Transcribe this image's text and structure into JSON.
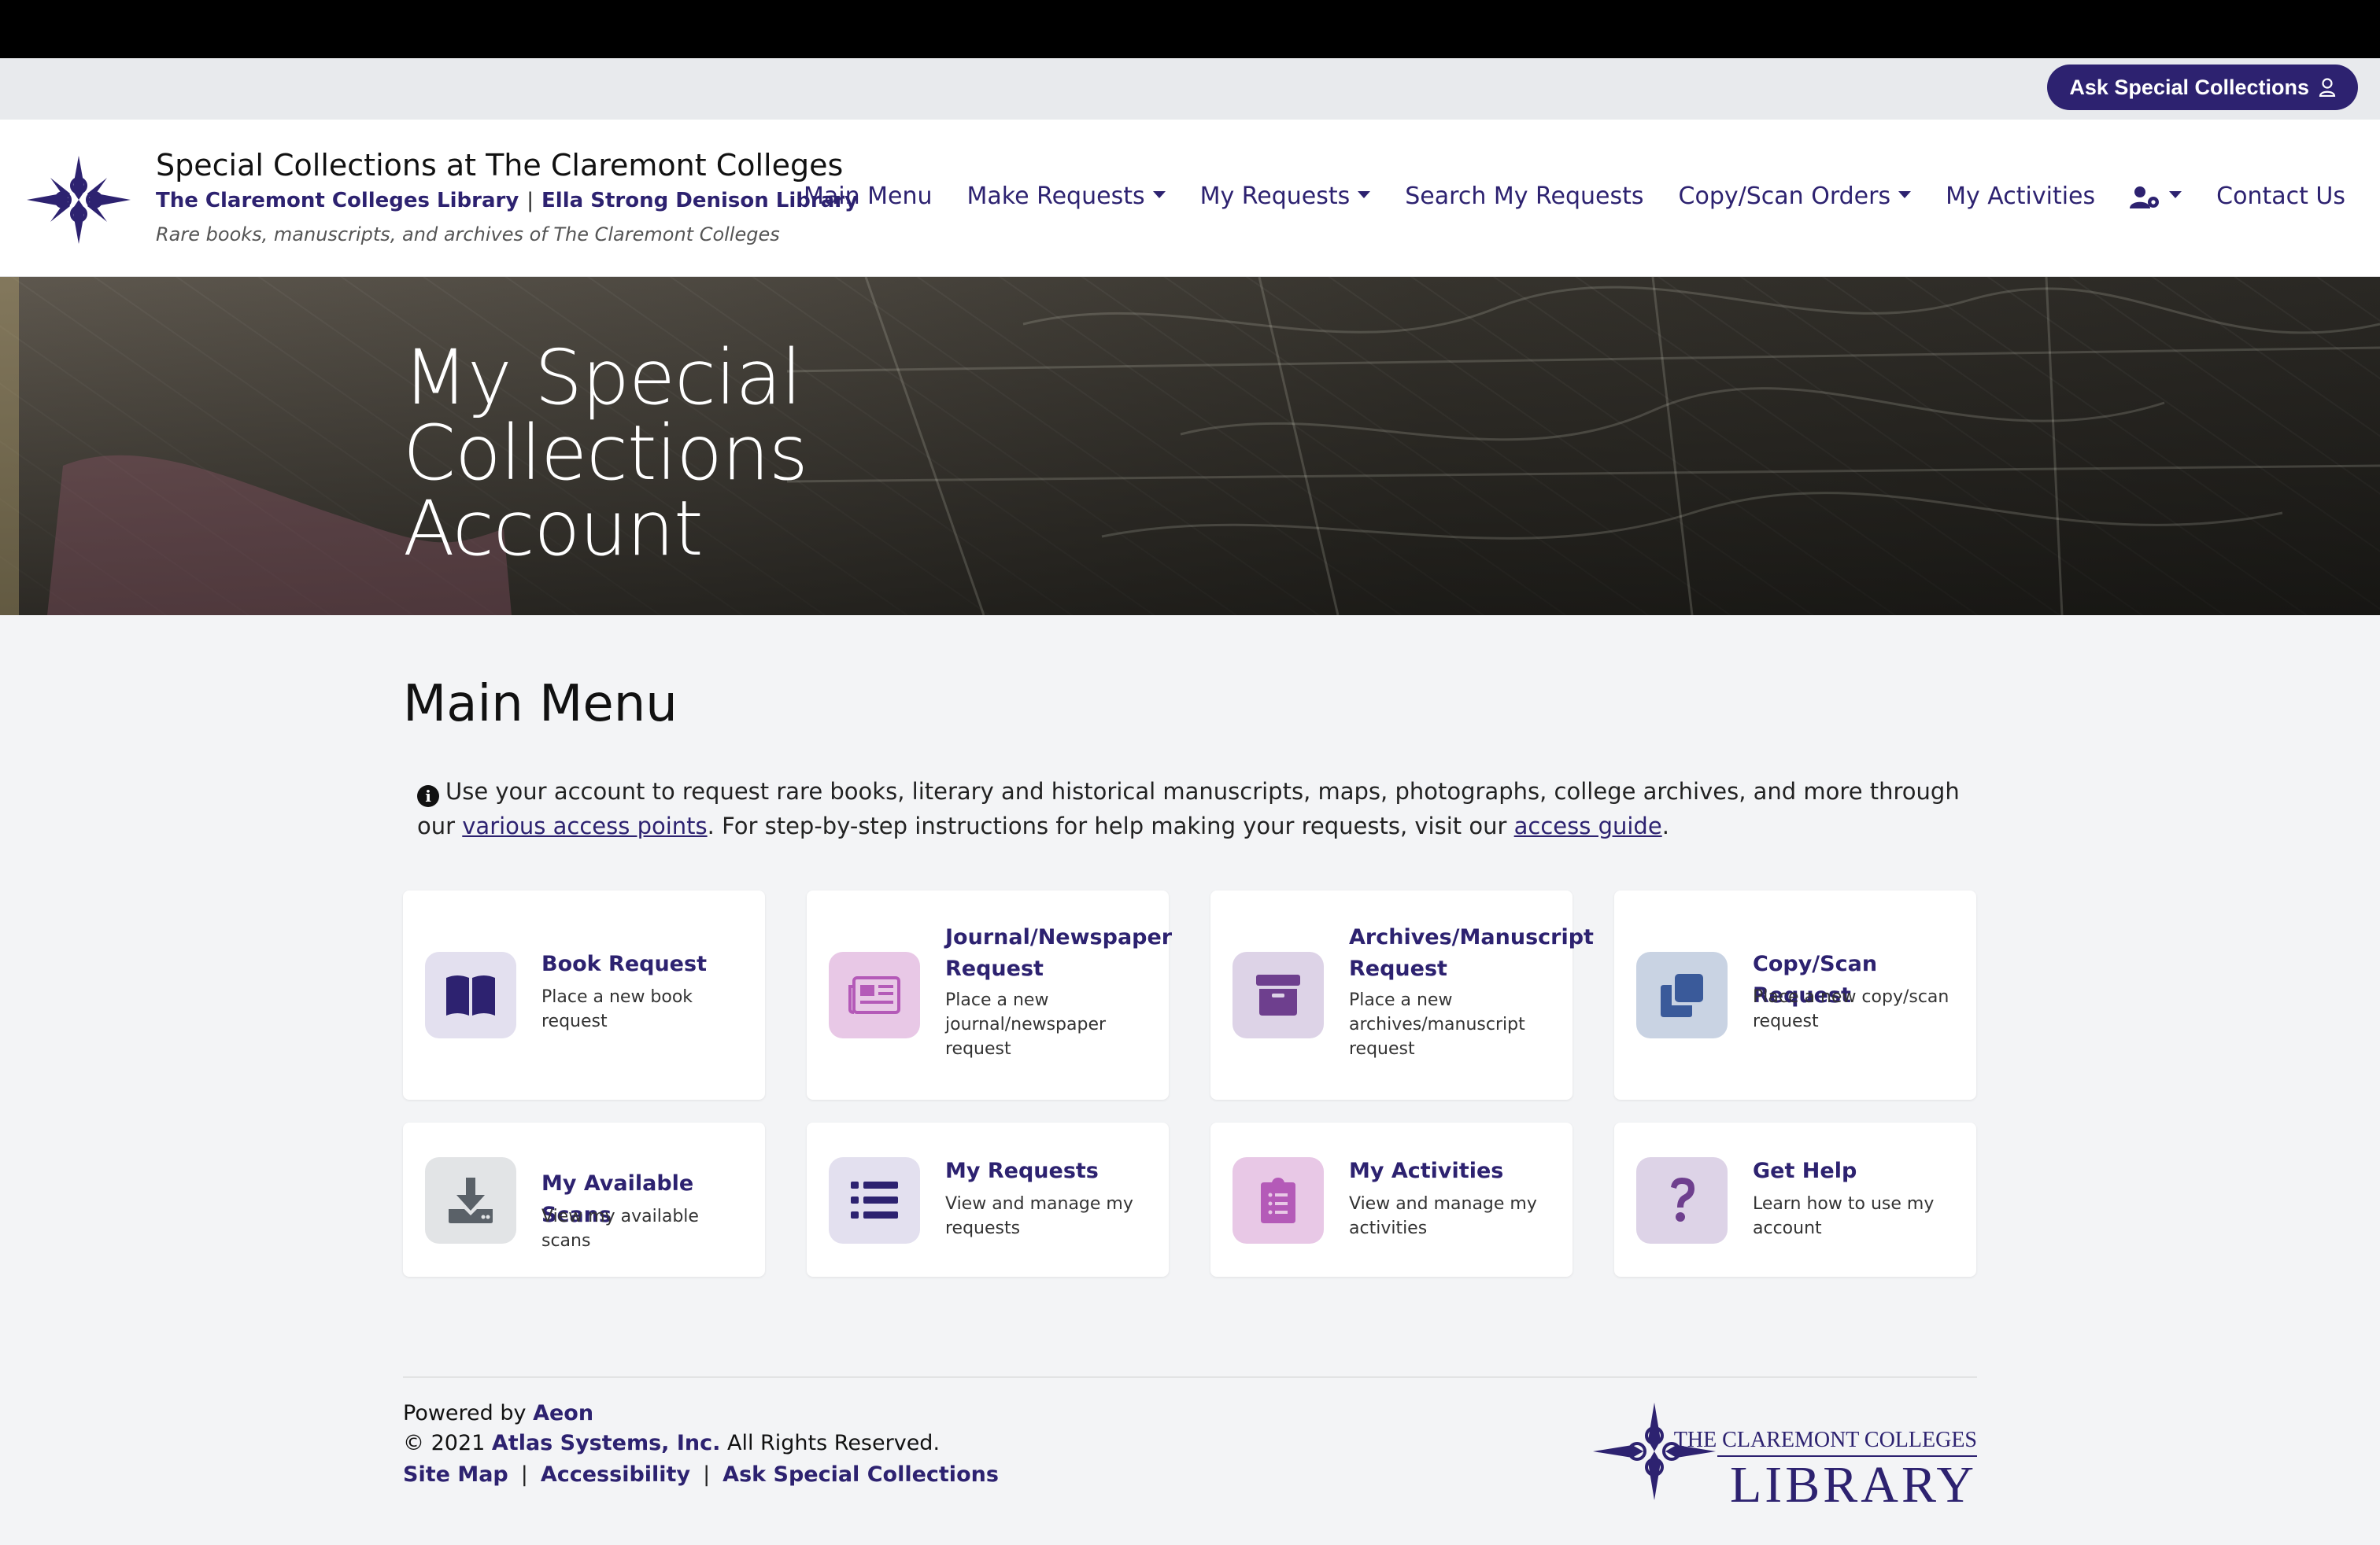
{
  "utility": {
    "ask_label": "Ask Special Collections",
    "icon": "person-outline-icon"
  },
  "header": {
    "title": "Special Collections at The Claremont Colleges",
    "link1": "The Claremont Colleges Library",
    "separator": "|",
    "link2": "Ella Strong Denison Library",
    "tagline": "Rare books, manuscripts, and archives of The Claremont Colleges"
  },
  "nav": {
    "items": [
      "Main Menu",
      "Make Requests",
      "My Requests",
      "Search My Requests",
      "Copy/Scan Orders",
      "My Activities",
      "Contact Us"
    ],
    "account_icon": "user-cog-icon"
  },
  "hero": {
    "line1": "My Special",
    "line2": "Collections",
    "line3": "Account"
  },
  "main": {
    "heading": "Main Menu",
    "intro_before": "Use your account to request rare books, literary and historical manuscripts, maps, photographs, college archives, and more through our ",
    "intro_link1": "various access points",
    "intro_middle": ". For step-by-step instructions for help making your requests, visit our ",
    "intro_link2": "access guide",
    "intro_after": "."
  },
  "cards": [
    {
      "title": "Book Request",
      "desc": "Place a new book request",
      "icon": "book-open-icon",
      "tile": "#e3e0ef",
      "fg": "#2d2270"
    },
    {
      "title": "Journal/Newspaper Request",
      "desc": "Place a new journal/newspaper request",
      "icon": "newspaper-icon",
      "tile": "#e8c8e6",
      "fg": "#b45ab8"
    },
    {
      "title": "Archives/Manuscript Request",
      "desc": "Place a new archives/manuscript request",
      "icon": "archive-box-icon",
      "tile": "#ddd3e7",
      "fg": "#6e3f8e"
    },
    {
      "title": "Copy/Scan Request",
      "desc": "Place a new copy/scan request",
      "icon": "copy-icon",
      "tile": "#c9d3e3",
      "fg": "#3a5a9a"
    },
    {
      "title": "My Available Scans",
      "desc": "View my available scans",
      "icon": "download-icon",
      "tile": "#e2e4e6",
      "fg": "#5a6168"
    },
    {
      "title": "My Requests",
      "desc": "View and manage my requests",
      "icon": "list-icon",
      "tile": "#e3e0ef",
      "fg": "#2d2270"
    },
    {
      "title": "My Activities",
      "desc": "View and manage my activities",
      "icon": "clipboard-list-icon",
      "tile": "#e8c8e6",
      "fg": "#b45ab8"
    },
    {
      "title": "Get Help",
      "desc": "Learn how to use my account",
      "icon": "question-icon",
      "tile": "#ddd3e7",
      "fg": "#6e3f8e"
    }
  ],
  "footer": {
    "powered_prefix": "Powered by",
    "powered_link": "Aeon",
    "copyright_prefix": "© 2021",
    "copyright_link": "Atlas Systems, Inc.",
    "copyright_suffix": "All Rights Reserved.",
    "links": [
      "Site Map",
      "Accessibility",
      "Ask Special Collections"
    ],
    "logo_line1": "THE CLAREMONT COLLEGES",
    "logo_line2": "LIBRARY"
  },
  "colors": {
    "brand": "#2d2270",
    "background": "#f3f4f6"
  }
}
